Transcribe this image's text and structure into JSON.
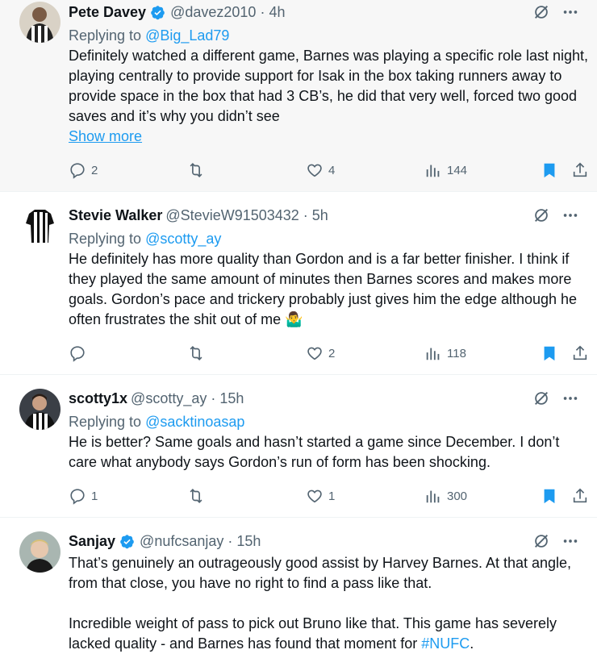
{
  "tweets": [
    {
      "name": "Pete Davey",
      "verified": true,
      "handle": "@davez2010",
      "time": "4h",
      "replying_label": "Replying to",
      "replying_to": "@Big_Lad79",
      "text": "Definitely watched a different game, Barnes was playing a specific role last night, playing centrally to provide support for Isak in the box taking runners away to provide space in the box that had 3 CB’s, he did that very well, forced two good saves and it’s why you didn’t see",
      "show_more": "Show more",
      "replies": "2",
      "retweets": "",
      "likes": "4",
      "views": "144"
    },
    {
      "name": "Stevie Walker",
      "verified": false,
      "handle": "@StevieW91503432",
      "time": "5h",
      "replying_label": "Replying to",
      "replying_to": "@scotty_ay",
      "text": "He definitely has more quality than Gordon and is a far better finisher. I think if they played the same amount of minutes then Barnes scores and makes more goals. Gordon’s pace and trickery probably just gives him the edge although he often frustrates the shit out of me 🤷‍♂️",
      "replies": "",
      "retweets": "",
      "likes": "2",
      "views": "118"
    },
    {
      "name": "scotty1x",
      "verified": false,
      "handle": "@scotty_ay",
      "time": "15h",
      "replying_label": "Replying to",
      "replying_to": "@sacktinoasap",
      "text": "He is better? Same goals and hasn’t started a game since December. I don’t care what anybody says Gordon’s run of form has been shocking.",
      "replies": "1",
      "retweets": "",
      "likes": "1",
      "views": "300"
    },
    {
      "name": "Sanjay",
      "verified": true,
      "handle": "@nufcsanjay",
      "time": "15h",
      "text_p1": "That’s genuinely an outrageously good assist by Harvey Barnes. At that angle, from that close, you have no right to find a pass like that.",
      "text_p2": "Incredible weight of pass to pick out Bruno like that. This game has severely lacked quality - and Barnes has found that moment for ",
      "hashtag": "#NUFC",
      "text_end": "."
    }
  ],
  "colors": {
    "accent": "#1d9bf0",
    "muted": "#536471",
    "text": "#0f1419",
    "highlight_bg": "#f7f7f7"
  }
}
